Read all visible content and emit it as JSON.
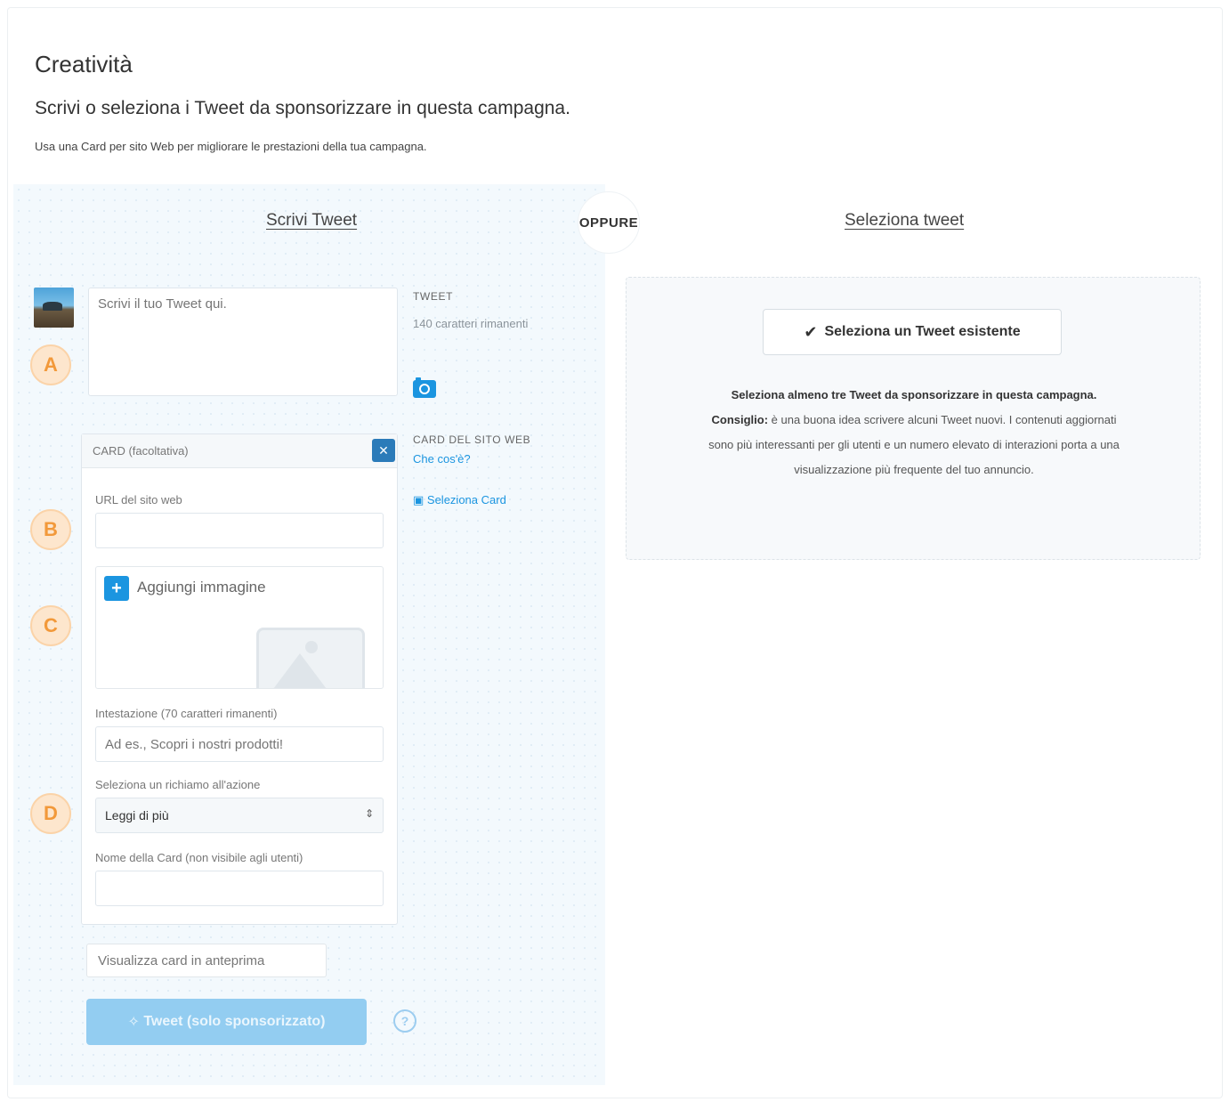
{
  "header": {
    "title": "Creatività",
    "subtitle": "Scrivi o seleziona i Tweet da sponsorizzare in questa campagna.",
    "note": "Usa una Card per sito Web per migliorare le prestazioni della tua campagna."
  },
  "tabs": {
    "write": "Scrivi Tweet",
    "or": "OPPURE",
    "select": "Seleziona tweet"
  },
  "compose": {
    "placeholder": "Scrivi il tuo Tweet qui.",
    "tweet_label": "TWEET",
    "chars_remaining": "140 caratteri rimanenti"
  },
  "badges": [
    "A",
    "B",
    "C",
    "D"
  ],
  "card": {
    "header": "CARD (facoltativa)",
    "side_label": "CARD DEL SITO WEB",
    "what_is": "Che cos'è?",
    "select_card": "Seleziona Card",
    "url_label": "URL del sito web",
    "add_image": "Aggiungi immagine",
    "headline_label": "Intestazione (70 caratteri rimanenti)",
    "headline_placeholder": "Ad es., Scopri i nostri prodotti!",
    "cta_label": "Seleziona un richiamo all'azione",
    "cta_value": "Leggi di più",
    "name_label": "Nome della Card (non visibile agli utenti)"
  },
  "actions": {
    "preview": "Visualizza card in anteprima",
    "tweet": "Tweet (solo sponsorizzato)",
    "help": "?"
  },
  "select_panel": {
    "button": "Seleziona un Tweet esistente",
    "line1": "Seleziona almeno tre Tweet da sponsorizzare in questa campagna.",
    "tip_bold": "Consiglio:",
    "tip": "è una buona idea scrivere alcuni Tweet nuovi. I contenuti aggiornati sono più interessanti per gli utenti e un numero elevato di interazioni porta a una visualizzazione più frequente del tuo annuncio."
  },
  "colors": {
    "accent": "#1b95e0",
    "tweet_button": "#93cdf1",
    "badge_fill": "#fde6cd",
    "badge_text": "#f2993a",
    "panel_bg": "#f3f9fd"
  }
}
